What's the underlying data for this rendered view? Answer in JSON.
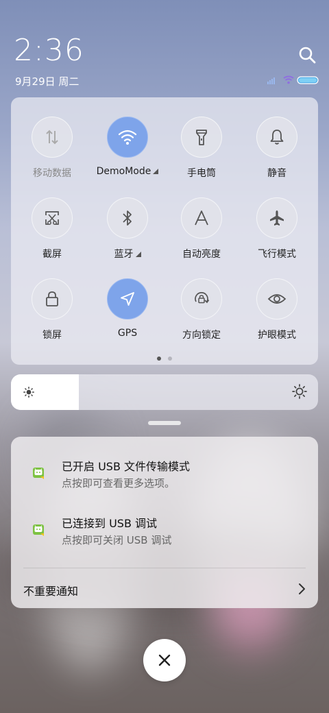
{
  "status": {
    "time": "2:36",
    "date": "9月29日 周二"
  },
  "quick_settings": {
    "tiles": [
      {
        "label": "移动数据",
        "state": "unavailable",
        "icon": "mobile-data-icon"
      },
      {
        "label": "DemoMode",
        "state": "on",
        "icon": "wifi-icon",
        "has_menu": true
      },
      {
        "label": "手电筒",
        "state": "off",
        "icon": "flashlight-icon"
      },
      {
        "label": "静音",
        "state": "off",
        "icon": "bell-icon"
      },
      {
        "label": "截屏",
        "state": "off",
        "icon": "screenshot-icon"
      },
      {
        "label": "蓝牙",
        "state": "off",
        "icon": "bluetooth-icon",
        "has_menu": true
      },
      {
        "label": "自动亮度",
        "state": "off",
        "icon": "auto-brightness-icon"
      },
      {
        "label": "飞行模式",
        "state": "off",
        "icon": "airplane-icon"
      },
      {
        "label": "锁屏",
        "state": "off",
        "icon": "lock-icon"
      },
      {
        "label": "GPS",
        "state": "on",
        "icon": "location-icon"
      },
      {
        "label": "方向锁定",
        "state": "off",
        "icon": "rotation-lock-icon"
      },
      {
        "label": "护眼模式",
        "state": "off",
        "icon": "eye-icon"
      }
    ],
    "page_count": 2,
    "current_page": 1
  },
  "brightness": {
    "level_fraction": 0.22
  },
  "notifications": [
    {
      "title": "已开启 USB 文件传输模式",
      "subtitle": "点按即可查看更多选项。",
      "icon": "android-icon"
    },
    {
      "title": "已连接到 USB 调试",
      "subtitle": "点按即可关闭 USB 调试",
      "icon": "android-icon"
    }
  ],
  "unimportant": {
    "label": "不重要通知"
  },
  "colors": {
    "accent": "#7ea4ea",
    "panel": "#ebecf3",
    "android_green": "#7dc242"
  }
}
